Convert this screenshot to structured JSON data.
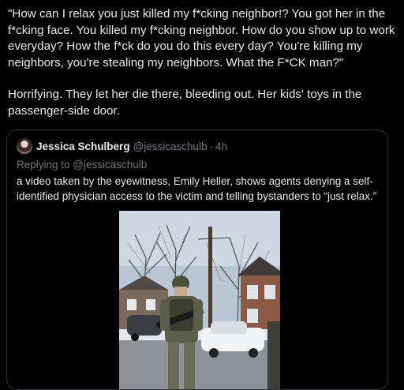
{
  "tweet": {
    "paragraph_1": "\"How can I relax you just killed my f*cking neighbor!? You got her in the f*cking face. You killed my f*cking neighbor. How do you show up to work everyday? How the f*ck do you do this every day? You're killing my neighbors, you're stealing my neighbors. What the F*CK man?\"",
    "paragraph_2": "Horrifying. They let her die there, bleeding out. Her kids' toys in the passenger-side door."
  },
  "quote": {
    "author_name": "Jessica Schulberg",
    "author_handle": "@jessicaschulb",
    "separator": "·",
    "time": "4h",
    "replying_to": "Replying to @jessicaschulb",
    "text": "a video taken by the eyewitness, Emily Heller, shows agents denying a self-identified physician access to the victim and telling bystanders to “just relax.”",
    "avatar_icon": "profile-photo",
    "media_icon": "video-thumbnail"
  },
  "colors": {
    "background": "#000000",
    "text_primary": "#e7e9ea",
    "text_secondary": "#71767b",
    "border": "#2f3336"
  }
}
